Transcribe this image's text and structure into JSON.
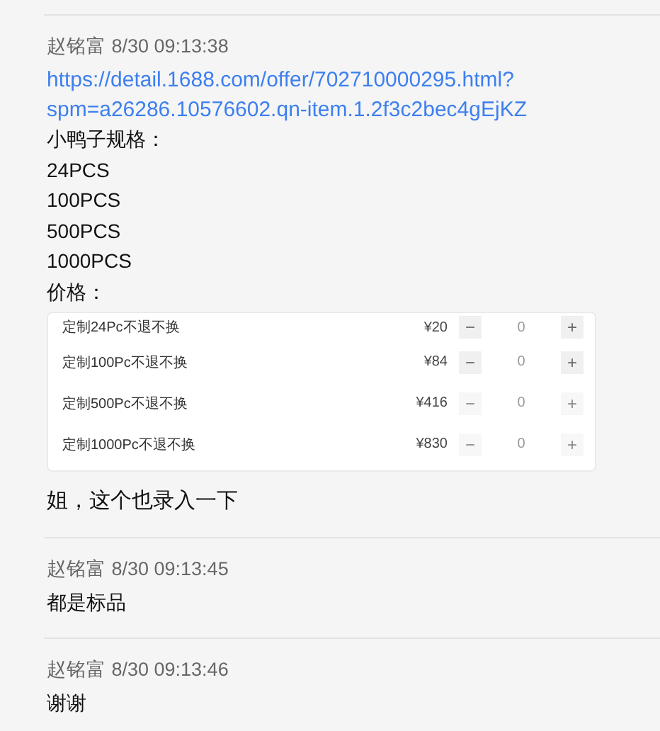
{
  "messages": [
    {
      "sender": "赵铭富",
      "time": "8/30 09:13:38",
      "blocks": [
        {
          "kind": "link",
          "text": "https://detail.1688.com/offer/702710000295.html?spm=a26286.10576602.qn-item.1.2f3c2bec4gEjKZ"
        },
        {
          "kind": "text",
          "text": "小鸭子规格："
        },
        {
          "kind": "text",
          "text": "24PCS"
        },
        {
          "kind": "text",
          "text": "100PCS"
        },
        {
          "kind": "text",
          "text": "500PCS"
        },
        {
          "kind": "text",
          "text": "1000PCS"
        },
        {
          "kind": "text",
          "text": "价格："
        },
        {
          "kind": "products",
          "rows": [
            {
              "name": "定制24Pc不退不换",
              "price": "¥20",
              "minus": "−",
              "quantity": "0",
              "plus": "+",
              "disabled": false
            },
            {
              "name": "定制100Pc不退不换",
              "price": "¥84",
              "minus": "−",
              "quantity": "0",
              "plus": "+",
              "disabled": false
            },
            {
              "name": "定制500Pc不退不换",
              "price": "¥416",
              "minus": "−",
              "quantity": "0",
              "plus": "+",
              "disabled": true
            },
            {
              "name": "定制1000Pc不退不换",
              "price": "¥830",
              "minus": "−",
              "quantity": "0",
              "plus": "+",
              "disabled": true
            }
          ]
        },
        {
          "kind": "text",
          "text": "姐，这个也录入一下",
          "spaced": true
        }
      ]
    },
    {
      "sender": "赵铭富",
      "time": "8/30 09:13:45",
      "blocks": [
        {
          "kind": "text",
          "text": "都是标品"
        }
      ]
    },
    {
      "sender": "赵铭富",
      "time": "8/30 09:13:46",
      "blocks": [
        {
          "kind": "text",
          "text": "谢谢"
        }
      ]
    }
  ]
}
